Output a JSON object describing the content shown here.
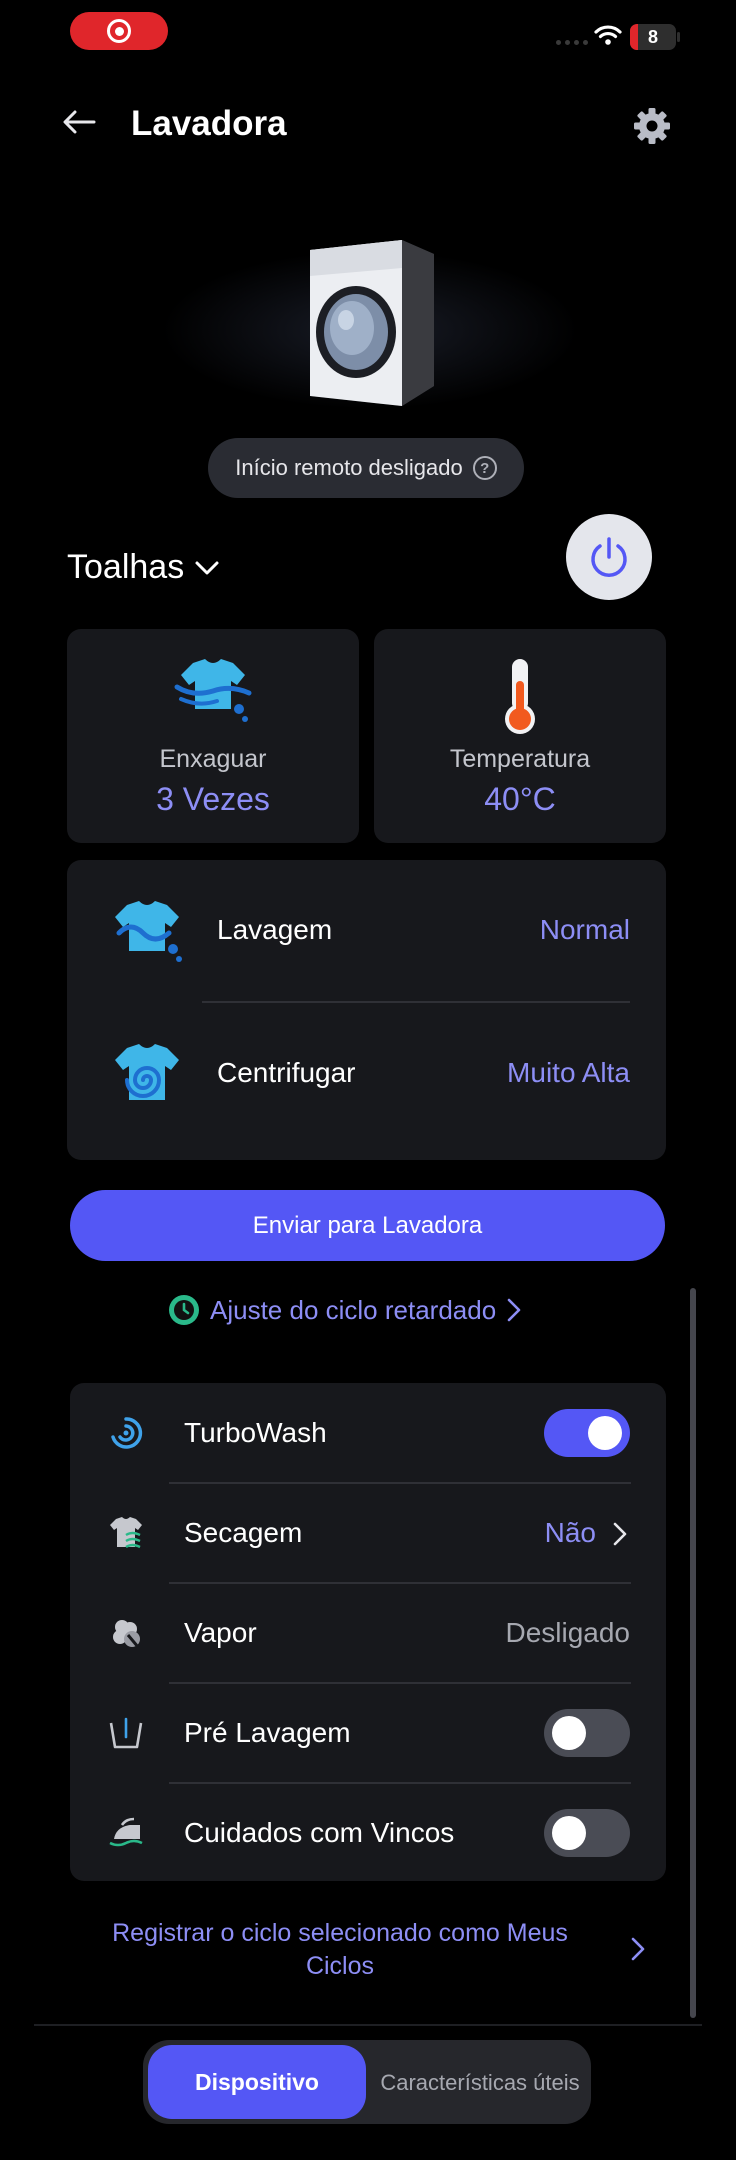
{
  "status_bar": {
    "battery": "8"
  },
  "header": {
    "title": "Lavadora"
  },
  "hero": {
    "remote_status": "Início remoto desligado",
    "help_glyph": "?"
  },
  "course": {
    "name": "Toalhas"
  },
  "options": {
    "rinse": {
      "label": "Enxaguar",
      "value": "3 Vezes"
    },
    "temperature": {
      "label": "Temperatura",
      "value": "40°C"
    },
    "wash": {
      "label": "Lavagem",
      "value": "Normal"
    },
    "spin": {
      "label": "Centrifugar",
      "value": "Muito Alta"
    }
  },
  "send_button": "Enviar para Lavadora",
  "delay_link": "Ajuste do ciclo retardado",
  "extra_options": [
    {
      "label": "TurboWash",
      "icon": "turbowash-icon",
      "control": "toggle",
      "on": true
    },
    {
      "label": "Secagem",
      "icon": "drying-icon",
      "control": "value",
      "value": "Não"
    },
    {
      "label": "Vapor",
      "icon": "steam-icon",
      "control": "value",
      "value": "Desligado"
    },
    {
      "label": "Pré Lavagem",
      "icon": "prewash-icon",
      "control": "toggle",
      "on": false
    },
    {
      "label": "Cuidados com Vincos",
      "icon": "crease-care-icon",
      "control": "toggle",
      "on": false
    }
  ],
  "register_link": "Registrar o ciclo selecionado como Meus Ciclos",
  "tabs": {
    "device": "Dispositivo",
    "features": "Características úteis"
  },
  "colors": {
    "accent": "#5457f5",
    "value_text": "#8d8ef5",
    "card": "#17181c",
    "background": "#000000"
  }
}
